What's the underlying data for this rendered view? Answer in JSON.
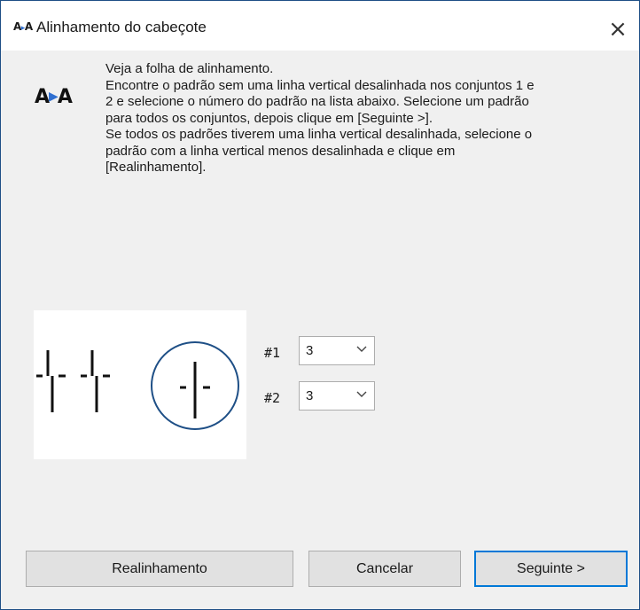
{
  "window": {
    "title": "Alinhamento do cabeçote",
    "icon": "head-alignment-icon",
    "close": "×"
  },
  "app_icon": {
    "name": "head-alignment-icon",
    "left": "A",
    "right": "A"
  },
  "instructions": [
    "Veja a folha de alinhamento.",
    "Encontre o padrão sem uma linha vertical desalinhada nos conjuntos 1 e",
    "2 e selecione o número do padrão na lista abaixo. Selecione um padrão",
    "para todos os conjuntos, depois clique em [Seguinte >].",
    "Se todos os padrões tiverem uma linha vertical desalinhada, selecione o",
    "padrão com a linha vertical menos desalinhada e clique em",
    "[Realinhamento]."
  ],
  "selectors": [
    {
      "label": "#1",
      "value": "3"
    },
    {
      "label": "#2",
      "value": "3"
    }
  ],
  "buttons": {
    "realign": "Realinhamento",
    "cancel": "Cancelar",
    "next": "Seguinte >"
  },
  "colors": {
    "accent": "#0078d7",
    "circle": "#1e4f86",
    "border": "#1e4f86"
  }
}
